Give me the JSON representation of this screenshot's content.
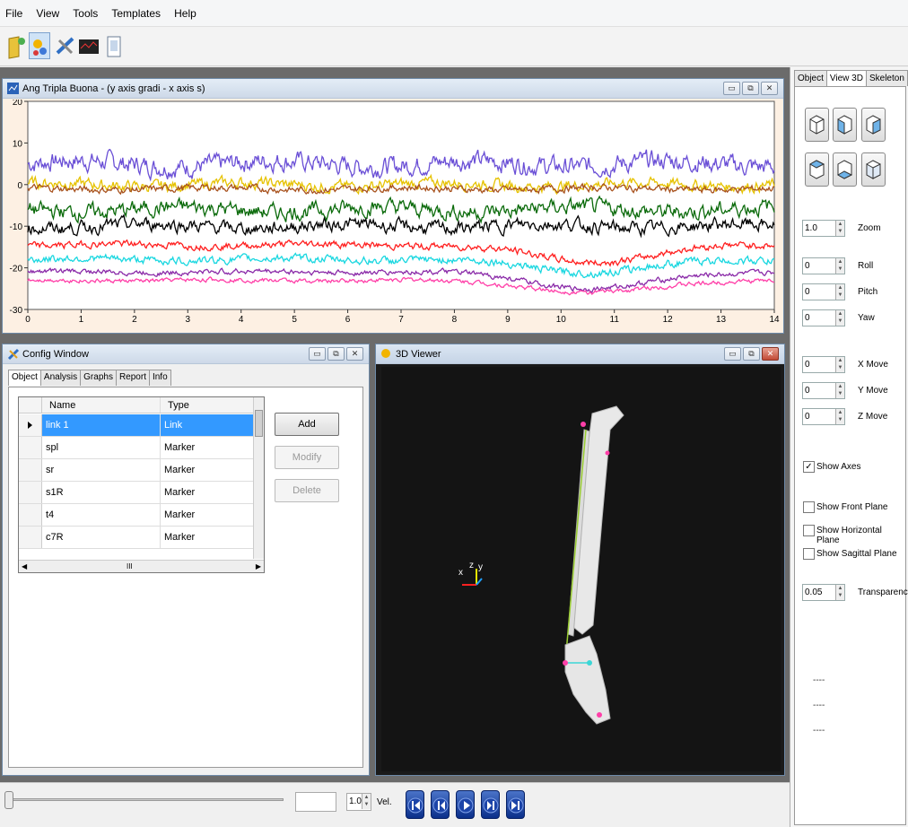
{
  "menu": [
    "File",
    "View",
    "Tools",
    "Templates",
    "Help"
  ],
  "toolbar": {
    "icons": [
      "open-folder-icon",
      "object-icon",
      "tools-icon",
      "graph-icon",
      "document-icon"
    ]
  },
  "chart_window": {
    "title": "Ang Tripla Buona - (y axis gradi - x axis s)",
    "buttons": [
      "▭",
      "⧉",
      "✕"
    ]
  },
  "chart_data": {
    "type": "line",
    "x_range": [
      0,
      14
    ],
    "y_range": [
      -30,
      20
    ],
    "x_ticks": [
      "0",
      "1",
      "2",
      "3",
      "4",
      "5",
      "6",
      "7",
      "8",
      "9",
      "10",
      "11",
      "12",
      "13",
      "14"
    ],
    "y_ticks": [
      "20",
      "10",
      "0",
      "-10",
      "-20",
      "-30"
    ],
    "grid": false,
    "series": [
      {
        "color": "#6a4fd6",
        "base": 5,
        "noise": 2.2,
        "dip": 0
      },
      {
        "color": "#e6c200",
        "base": 0,
        "noise": 1.3,
        "dip": 0
      },
      {
        "color": "#a8521e",
        "base": -1,
        "noise": 0.8,
        "dip": 0
      },
      {
        "color": "#0a6a0a",
        "base": -6,
        "noise": 1.8,
        "dip": 0
      },
      {
        "color": "#000000",
        "base": -10,
        "noise": 1.5,
        "dip": 0
      },
      {
        "color": "#ff1f1f",
        "base": -14.5,
        "noise": 0.8,
        "dip": 4
      },
      {
        "color": "#19d7e0",
        "base": -18,
        "noise": 0.9,
        "dip": 3
      },
      {
        "color": "#8a2aa8",
        "base": -21,
        "noise": 0.6,
        "dip": 4
      },
      {
        "color": "#ff3fa8",
        "base": -23,
        "noise": 0.5,
        "dip": 3
      }
    ]
  },
  "config_window": {
    "title": "Config Window",
    "tabs": [
      "Object",
      "Analysis",
      "Graphs",
      "Report",
      "Info"
    ],
    "columns": [
      "Name",
      "Type"
    ],
    "rows": [
      {
        "name": "link 1",
        "type": "Link"
      },
      {
        "name": "spl",
        "type": "Marker"
      },
      {
        "name": "sr",
        "type": "Marker"
      },
      {
        "name": "s1R",
        "type": "Marker"
      },
      {
        "name": "t4",
        "type": "Marker"
      },
      {
        "name": "c7R",
        "type": "Marker"
      }
    ],
    "hscroll_label": "III",
    "add": "Add",
    "modify": "Modify",
    "delete": "Delete"
  },
  "viewer_window": {
    "title": "3D Viewer",
    "axes": {
      "x": "x",
      "y": "y",
      "z": "z"
    }
  },
  "right_panel": {
    "tabs": [
      "Object",
      "View 3D",
      "Skeleton"
    ],
    "zoom": {
      "value": "1.0",
      "label": "Zoom"
    },
    "roll": {
      "value": "0",
      "label": "Roll"
    },
    "pitch": {
      "value": "0",
      "label": "Pitch"
    },
    "yaw": {
      "value": "0",
      "label": "Yaw"
    },
    "xmove": {
      "value": "0",
      "label": "X Move"
    },
    "ymove": {
      "value": "0",
      "label": "Y Move"
    },
    "zmove": {
      "value": "0",
      "label": "Z Move"
    },
    "show_axes": {
      "label": "Show Axes",
      "checked": true
    },
    "show_front": {
      "label": "Show Front Plane",
      "checked": false
    },
    "show_horizontal": {
      "label": "Show Horizontal Plane",
      "checked": false
    },
    "show_sagittal": {
      "label": "Show Sagittal Plane",
      "checked": false
    },
    "transparency": {
      "value": "0.05",
      "label": "Transparency"
    },
    "dashes": [
      "----",
      "----",
      "----"
    ]
  },
  "bottom": {
    "speed": "1.0",
    "vel_label": "Vel.",
    "time_value": ""
  }
}
